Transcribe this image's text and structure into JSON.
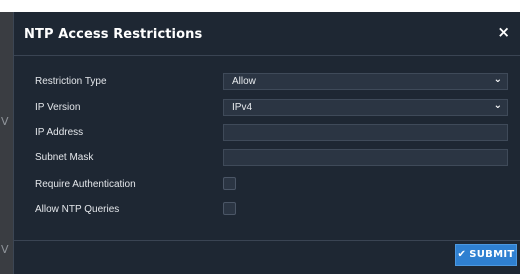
{
  "modal": {
    "title": "NTP Access Restrictions",
    "close_glyph": "×"
  },
  "background": {
    "edge_char": "V"
  },
  "form": {
    "restriction_type": {
      "label": "Restriction Type",
      "value": "Allow"
    },
    "ip_version": {
      "label": "IP Version",
      "value": "IPv4"
    },
    "ip_address": {
      "label": "IP Address",
      "value": ""
    },
    "subnet_mask": {
      "label": "Subnet Mask",
      "value": ""
    },
    "require_auth": {
      "label": "Require Authentication",
      "checked": false
    },
    "allow_queries": {
      "label": "Allow NTP Queries",
      "checked": false
    }
  },
  "footer": {
    "submit_label": "SUBMIT"
  },
  "icons": {
    "chevron": "chevron-down-icon",
    "close": "close-icon",
    "check": "check-icon"
  },
  "colors": {
    "modal_bg": "#1e2733",
    "input_bg": "#2b3543",
    "accent": "#2f80d1"
  }
}
